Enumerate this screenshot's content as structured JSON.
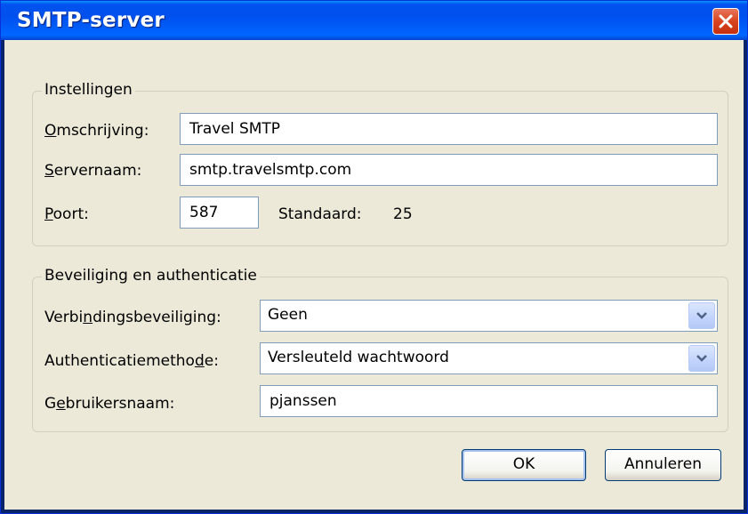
{
  "window": {
    "title": "SMTP-server"
  },
  "settings_group": {
    "legend": "Instellingen",
    "description": {
      "label_accesskey": "O",
      "label_rest": "mschrijving:",
      "value": "Travel SMTP"
    },
    "server_name": {
      "label_accesskey": "S",
      "label_rest": "ervernaam:",
      "value": "smtp.travelsmtp.com"
    },
    "port": {
      "label_accesskey": "P",
      "label_rest": "oort:",
      "value": "587",
      "default_label": "Standaard:",
      "default_value": "25"
    }
  },
  "security_group": {
    "legend": "Beveiliging en authenticatie",
    "connection_security": {
      "label_pre": "Verbi",
      "label_accesskey": "n",
      "label_post": "dingsbeveiliging:",
      "selected": "Geen"
    },
    "auth_method": {
      "label_pre": "Authenticatiemetho",
      "label_accesskey": "d",
      "label_post": "e:",
      "selected": "Versleuteld wachtwoord"
    },
    "username": {
      "label_pre": "G",
      "label_accesskey": "e",
      "label_post": "bruikersnaam:",
      "value": "pjanssen"
    }
  },
  "buttons": {
    "ok": "OK",
    "cancel": "Annuleren"
  },
  "icons": {
    "close": "close-icon",
    "dropdown": "chevron-down-icon"
  },
  "colors": {
    "titlebar": "#0054e3",
    "close_button": "#d8431f",
    "dialog_bg": "#ece9d8",
    "field_border": "#7f9db9"
  }
}
